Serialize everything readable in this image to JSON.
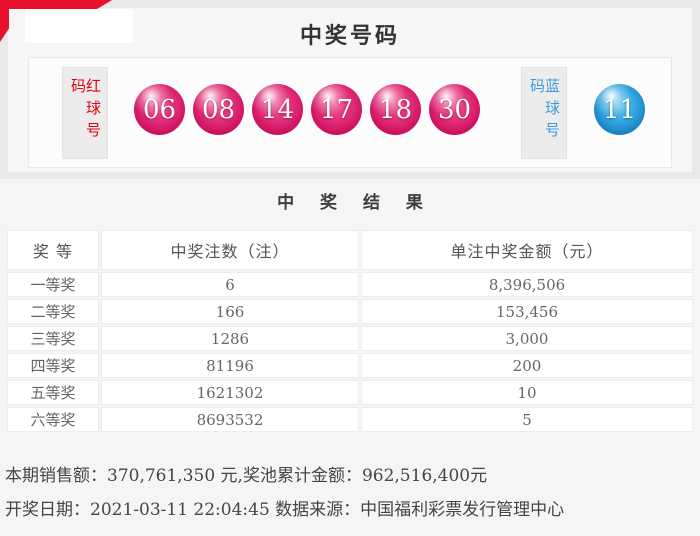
{
  "page": {
    "title": "中奖号码",
    "results_title": "中 奖 结 果"
  },
  "winning_numbers": {
    "red_label": "红球号码",
    "red_balls": [
      "06",
      "08",
      "14",
      "17",
      "18",
      "30"
    ],
    "blue_label": "蓝球号码",
    "blue_ball": "11"
  },
  "results_table": {
    "headers": [
      "奖 等",
      "中奖注数（注）",
      "单注中奖金额（元）"
    ],
    "rows": [
      {
        "level": "一等奖",
        "count": "6",
        "amount": "8,396,506"
      },
      {
        "level": "二等奖",
        "count": "166",
        "amount": "153,456"
      },
      {
        "level": "三等奖",
        "count": "1286",
        "amount": "3,000"
      },
      {
        "level": "四等奖",
        "count": "81196",
        "amount": "200"
      },
      {
        "level": "五等奖",
        "count": "1621302",
        "amount": "10"
      },
      {
        "level": "六等奖",
        "count": "8693532",
        "amount": "5"
      }
    ]
  },
  "footer": {
    "sales_line": "本期销售额：370,761,350 元,奖池累计金额：962,516,400元",
    "date_line": "开奖日期：2021-03-11 22:04:45 数据来源：中国福利彩票发行管理中心"
  },
  "colors": {
    "accent_red": "#e8112d",
    "red_ball": "#e02a74",
    "blue_ball": "#2fa3de",
    "red_label_text": "#e60012",
    "blue_label_text": "#3e9bdb"
  }
}
